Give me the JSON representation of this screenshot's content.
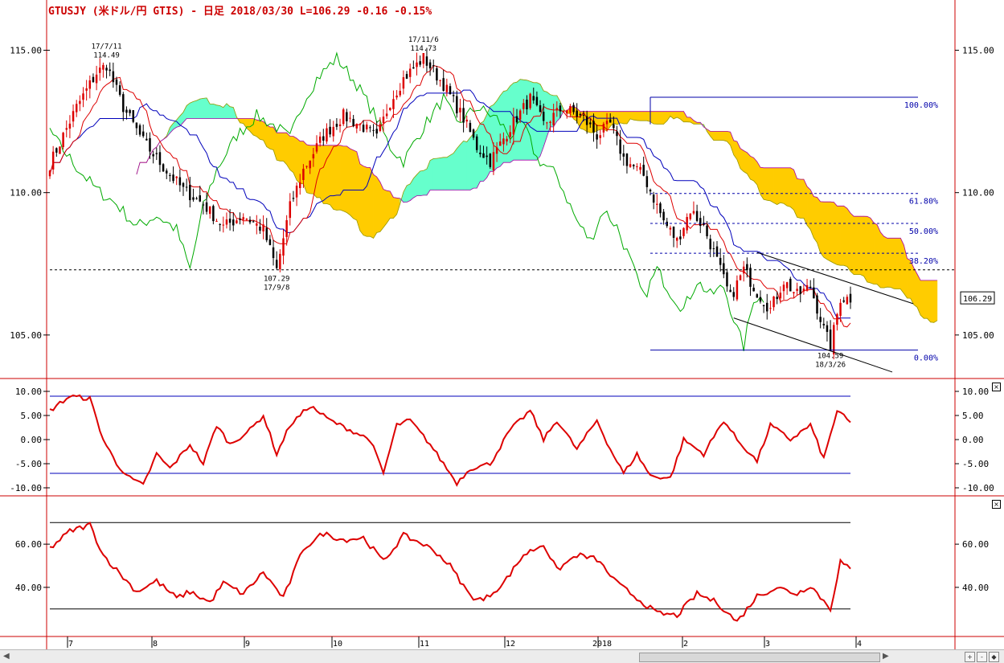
{
  "header": {
    "title": "GTUSJY (米ドル/円 GTIS) - 日足 2018/03/30 L=106.29 -0.16 -0.15%"
  },
  "colors": {
    "frame": "#cc0000",
    "candle_up": "#dd0000",
    "candle_down": "#000000",
    "tenkan": "#dd0000",
    "kijun": "#0000bb",
    "chikou": "#00aa00",
    "cloud_bull": "#66ffcc",
    "cloud_bear": "#ffcc00",
    "fib": "#0000aa",
    "osc": "#dd0000"
  },
  "chart_data": [
    {
      "type": "candlestick",
      "panel": "price",
      "ylim": [
        103.5,
        116.2
      ],
      "y_ticks": [
        "115.00",
        "110.00",
        "105.00"
      ],
      "x_ticks": [
        "7",
        "8",
        "9",
        "10",
        "11",
        "12",
        "2018",
        "2",
        "3",
        "4"
      ],
      "last_price_label": "106.29",
      "keypoints": [
        {
          "t": 0,
          "v": 111.0
        },
        {
          "t": 8,
          "v": 113.0
        },
        {
          "t": 14,
          "v": 114.2
        },
        {
          "t": 17,
          "v": 114.49
        },
        {
          "t": 22,
          "v": 113.0
        },
        {
          "t": 28,
          "v": 111.8
        },
        {
          "t": 34,
          "v": 110.9
        },
        {
          "t": 40,
          "v": 110.1
        },
        {
          "t": 46,
          "v": 109.6
        },
        {
          "t": 52,
          "v": 108.8
        },
        {
          "t": 58,
          "v": 109.2
        },
        {
          "t": 64,
          "v": 108.7
        },
        {
          "t": 68,
          "v": 107.29
        },
        {
          "t": 72,
          "v": 109.5
        },
        {
          "t": 76,
          "v": 110.8
        },
        {
          "t": 82,
          "v": 112.0
        },
        {
          "t": 88,
          "v": 112.7
        },
        {
          "t": 94,
          "v": 112.3
        },
        {
          "t": 98,
          "v": 111.9
        },
        {
          "t": 102,
          "v": 113.2
        },
        {
          "t": 106,
          "v": 114.0
        },
        {
          "t": 112,
          "v": 114.73
        },
        {
          "t": 118,
          "v": 113.8
        },
        {
          "t": 124,
          "v": 112.6
        },
        {
          "t": 128,
          "v": 111.6
        },
        {
          "t": 132,
          "v": 111.1
        },
        {
          "t": 138,
          "v": 112.3
        },
        {
          "t": 144,
          "v": 113.3
        },
        {
          "t": 148,
          "v": 112.4
        },
        {
          "t": 154,
          "v": 113.0
        },
        {
          "t": 160,
          "v": 112.6
        },
        {
          "t": 164,
          "v": 112.0
        },
        {
          "t": 168,
          "v": 112.4
        },
        {
          "t": 172,
          "v": 111.2
        },
        {
          "t": 178,
          "v": 110.6
        },
        {
          "t": 184,
          "v": 109.0
        },
        {
          "t": 188,
          "v": 108.3
        },
        {
          "t": 192,
          "v": 109.4
        },
        {
          "t": 196,
          "v": 108.8
        },
        {
          "t": 200,
          "v": 107.6
        },
        {
          "t": 204,
          "v": 106.3
        },
        {
          "t": 208,
          "v": 107.3
        },
        {
          "t": 212,
          "v": 106.5
        },
        {
          "t": 216,
          "v": 105.9
        },
        {
          "t": 220,
          "v": 106.9
        },
        {
          "t": 224,
          "v": 106.4
        },
        {
          "t": 228,
          "v": 106.7
        },
        {
          "t": 232,
          "v": 105.2
        },
        {
          "t": 234,
          "v": 104.59
        },
        {
          "t": 237,
          "v": 106.3
        },
        {
          "t": 240,
          "v": 106.29
        }
      ],
      "annotations": [
        {
          "date": "17/7/11",
          "value": "114.49",
          "t": 17,
          "pos": "above"
        },
        {
          "date": "17/11/6",
          "value": "114.73",
          "t": 112,
          "pos": "above"
        },
        {
          "value": "107.29",
          "date": "17/9/8",
          "t": 68,
          "pos": "below"
        },
        {
          "value": "104.59",
          "date": "18/3/26",
          "t": 234,
          "pos": "below"
        }
      ],
      "fibonacci": [
        {
          "label": "100.00%",
          "value": 113.35
        },
        {
          "label": "61.80%",
          "value": 109.97
        },
        {
          "label": "50.00%",
          "value": 108.92
        },
        {
          "label": "38.20%",
          "value": 107.87
        },
        {
          "label": "0.00%",
          "value": 104.47
        }
      ],
      "horizontal_line": 107.29
    },
    {
      "type": "line",
      "panel": "oscillator1",
      "ylim": [
        -11.5,
        12.5
      ],
      "y_ticks": [
        "10.00",
        "5.00",
        "0.00",
        "-5.00",
        "-10.00"
      ],
      "bands": [
        9.0,
        -7.0
      ],
      "keypoints": [
        {
          "t": 0,
          "v": 6
        },
        {
          "t": 6,
          "v": 9
        },
        {
          "t": 12,
          "v": 8.5
        },
        {
          "t": 16,
          "v": 0
        },
        {
          "t": 20,
          "v": -5
        },
        {
          "t": 24,
          "v": -8
        },
        {
          "t": 28,
          "v": -9.5
        },
        {
          "t": 32,
          "v": -3
        },
        {
          "t": 36,
          "v": -6
        },
        {
          "t": 42,
          "v": -1
        },
        {
          "t": 46,
          "v": -5
        },
        {
          "t": 50,
          "v": 3
        },
        {
          "t": 54,
          "v": -1
        },
        {
          "t": 60,
          "v": 2
        },
        {
          "t": 64,
          "v": 5
        },
        {
          "t": 68,
          "v": -3
        },
        {
          "t": 72,
          "v": 3
        },
        {
          "t": 78,
          "v": 7
        },
        {
          "t": 84,
          "v": 4
        },
        {
          "t": 90,
          "v": 2
        },
        {
          "t": 96,
          "v": 0
        },
        {
          "t": 100,
          "v": -7
        },
        {
          "t": 104,
          "v": 3
        },
        {
          "t": 108,
          "v": 4
        },
        {
          "t": 114,
          "v": -1
        },
        {
          "t": 118,
          "v": -5
        },
        {
          "t": 122,
          "v": -9
        },
        {
          "t": 126,
          "v": -6
        },
        {
          "t": 132,
          "v": -5
        },
        {
          "t": 138,
          "v": 2
        },
        {
          "t": 144,
          "v": 6
        },
        {
          "t": 148,
          "v": 0
        },
        {
          "t": 152,
          "v": 4
        },
        {
          "t": 158,
          "v": -2
        },
        {
          "t": 164,
          "v": 4
        },
        {
          "t": 168,
          "v": -2
        },
        {
          "t": 172,
          "v": -7
        },
        {
          "t": 176,
          "v": -3
        },
        {
          "t": 180,
          "v": -7.5
        },
        {
          "t": 186,
          "v": -8
        },
        {
          "t": 190,
          "v": 0
        },
        {
          "t": 196,
          "v": -3
        },
        {
          "t": 202,
          "v": 4
        },
        {
          "t": 206,
          "v": 0
        },
        {
          "t": 212,
          "v": -4.5
        },
        {
          "t": 216,
          "v": 3
        },
        {
          "t": 222,
          "v": 0
        },
        {
          "t": 228,
          "v": 3
        },
        {
          "t": 232,
          "v": -4
        },
        {
          "t": 236,
          "v": 6
        },
        {
          "t": 240,
          "v": 3.5
        }
      ]
    },
    {
      "type": "line",
      "panel": "oscillator2",
      "ylim": [
        18,
        82
      ],
      "y_ticks": [
        "60.00",
        "40.00"
      ],
      "bands": [
        70,
        30
      ],
      "keypoints": [
        {
          "t": 0,
          "v": 58
        },
        {
          "t": 6,
          "v": 66
        },
        {
          "t": 12,
          "v": 69
        },
        {
          "t": 16,
          "v": 55
        },
        {
          "t": 20,
          "v": 48
        },
        {
          "t": 26,
          "v": 38
        },
        {
          "t": 32,
          "v": 43
        },
        {
          "t": 38,
          "v": 35
        },
        {
          "t": 42,
          "v": 38
        },
        {
          "t": 48,
          "v": 33
        },
        {
          "t": 52,
          "v": 42
        },
        {
          "t": 58,
          "v": 37
        },
        {
          "t": 64,
          "v": 47
        },
        {
          "t": 70,
          "v": 35
        },
        {
          "t": 76,
          "v": 58
        },
        {
          "t": 82,
          "v": 65
        },
        {
          "t": 88,
          "v": 62
        },
        {
          "t": 94,
          "v": 63
        },
        {
          "t": 100,
          "v": 52
        },
        {
          "t": 106,
          "v": 64
        },
        {
          "t": 112,
          "v": 60
        },
        {
          "t": 116,
          "v": 56
        },
        {
          "t": 120,
          "v": 50
        },
        {
          "t": 126,
          "v": 36
        },
        {
          "t": 130,
          "v": 34
        },
        {
          "t": 136,
          "v": 42
        },
        {
          "t": 142,
          "v": 55
        },
        {
          "t": 148,
          "v": 60
        },
        {
          "t": 152,
          "v": 48
        },
        {
          "t": 158,
          "v": 55
        },
        {
          "t": 164,
          "v": 53
        },
        {
          "t": 170,
          "v": 42
        },
        {
          "t": 176,
          "v": 35
        },
        {
          "t": 182,
          "v": 28
        },
        {
          "t": 188,
          "v": 27
        },
        {
          "t": 194,
          "v": 37
        },
        {
          "t": 200,
          "v": 33
        },
        {
          "t": 206,
          "v": 24
        },
        {
          "t": 212,
          "v": 36
        },
        {
          "t": 218,
          "v": 40
        },
        {
          "t": 224,
          "v": 37
        },
        {
          "t": 228,
          "v": 41
        },
        {
          "t": 234,
          "v": 30
        },
        {
          "t": 237,
          "v": 52
        },
        {
          "t": 240,
          "v": 48
        }
      ]
    }
  ]
}
